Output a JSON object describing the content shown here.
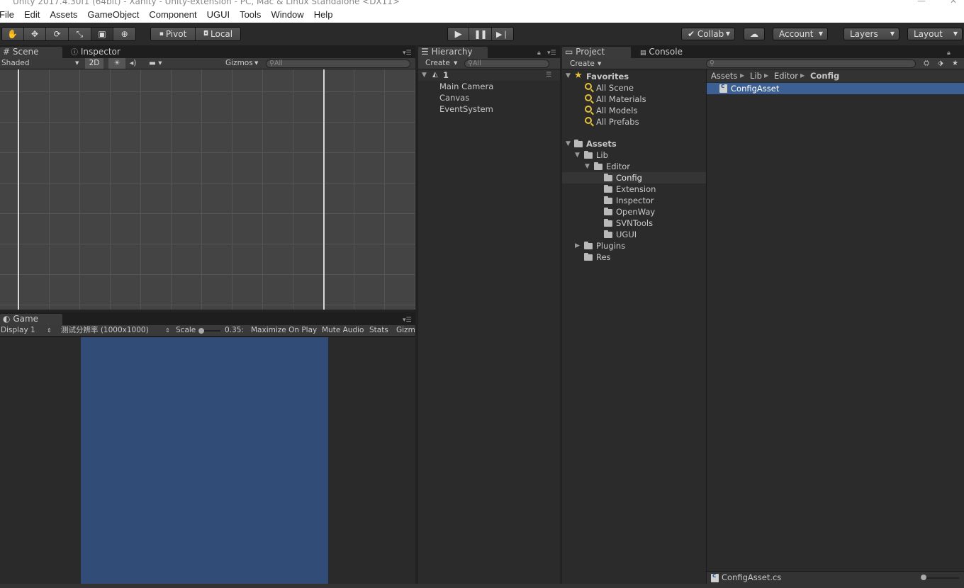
{
  "window": {
    "title": "Unity 2017.4.30f1 (64bit) - Xanity - Unity-extension - PC, Mac & Linux Standalone <DX11>"
  },
  "menu": [
    "File",
    "Edit",
    "Assets",
    "GameObject",
    "Component",
    "UGUI",
    "Tools",
    "Window",
    "Help"
  ],
  "toolbar": {
    "pivot_label": "Pivot",
    "local_label": "Local",
    "collab_label": "Collab",
    "account_label": "Account",
    "layers_label": "Layers",
    "layout_label": "Layout"
  },
  "scene_panel": {
    "tabs": [
      "Scene",
      "Inspector"
    ],
    "shading_mode": "Shaded",
    "mode_2d": "2D",
    "gizmos_label": "Gizmos",
    "search_placeholder": "All"
  },
  "game_panel": {
    "tab": "Game",
    "display": "Display 1",
    "resolution": "测试分辨率 (1000x1000)",
    "scale_label": "Scale",
    "scale_value": "0.35:",
    "maximize_label": "Maximize On Play",
    "mute_label": "Mute Audio",
    "stats_label": "Stats",
    "gizmos_label": "Gizmos"
  },
  "hierarchy": {
    "tab": "Hierarchy",
    "create_label": "Create",
    "search_placeholder": "All",
    "scene_name": "1",
    "items": [
      "Main Camera",
      "Canvas",
      "EventSystem"
    ]
  },
  "project": {
    "tabs": [
      "Project",
      "Console"
    ],
    "create_label": "Create",
    "favorites_label": "Favorites",
    "favorites": [
      "All Scene",
      "All Materials",
      "All Models",
      "All Prefabs"
    ],
    "assets_label": "Assets",
    "lib_label": "Lib",
    "editor_label": "Editor",
    "editor_children": [
      "Config",
      "Extension",
      "Inspector",
      "OpenWay",
      "SVNTools",
      "UGUI"
    ],
    "plugins_label": "Plugins",
    "res_label": "Res",
    "breadcrumb": [
      "Assets",
      "Lib",
      "Editor",
      "Config"
    ],
    "selected_file": "ConfigAsset",
    "footer_file": "ConfigAsset.cs"
  },
  "colors": {
    "game_background": "#314d77",
    "selection": "#3c5f94",
    "favorite_icon": "#e4c33b"
  }
}
